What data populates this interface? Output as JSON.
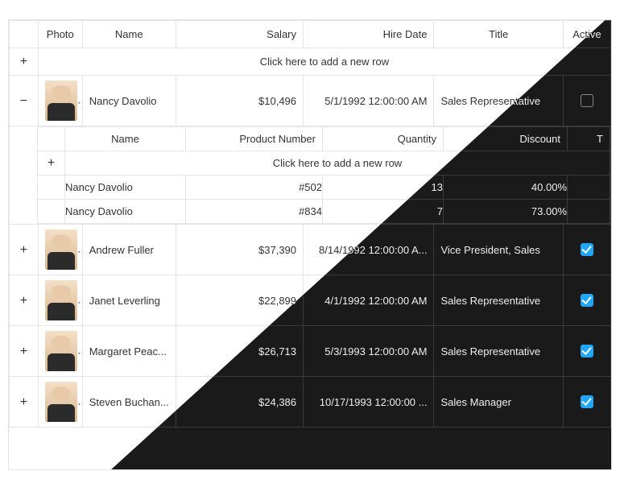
{
  "columns": {
    "photo": "Photo",
    "name": "Name",
    "salary": "Salary",
    "hire_date": "Hire Date",
    "title": "Title",
    "active": "Active"
  },
  "add_row_text": "Click here to add a new row",
  "nested_columns": {
    "name": "Name",
    "product_number": "Product Number",
    "quantity": "Quantity",
    "discount": "Discount",
    "total_partial": "T"
  },
  "nested_add_row_text": "Click here to add a new row",
  "rows": [
    {
      "expanded": true,
      "name": "Nancy Davolio",
      "salary": "$10,496",
      "hire_date": "5/1/1992 12:00:00 AM",
      "title": "Sales Representative",
      "active": false,
      "details": [
        {
          "name": "Nancy Davolio",
          "product_number": "#502",
          "quantity": "13",
          "discount": "40.00%"
        },
        {
          "name": "Nancy Davolio",
          "product_number": "#834",
          "quantity": "7",
          "discount": "73.00%"
        }
      ]
    },
    {
      "expanded": false,
      "name": "Andrew Fuller",
      "salary": "$37,390",
      "hire_date": "8/14/1992 12:00:00 A...",
      "title": "Vice President, Sales",
      "active": true
    },
    {
      "expanded": false,
      "name": "Janet Leverling",
      "salary": "$22,899",
      "hire_date": "4/1/1992 12:00:00 AM",
      "title": "Sales Representative",
      "active": true
    },
    {
      "expanded": false,
      "name": "Margaret Peac...",
      "salary": "$26,713",
      "hire_date": "5/3/1993 12:00:00 AM",
      "title": "Sales Representative",
      "active": true
    },
    {
      "expanded": false,
      "name": "Steven Buchan...",
      "salary": "$24,386",
      "hire_date": "10/17/1993 12:00:00 ...",
      "title": "Sales Manager",
      "active": true
    }
  ]
}
